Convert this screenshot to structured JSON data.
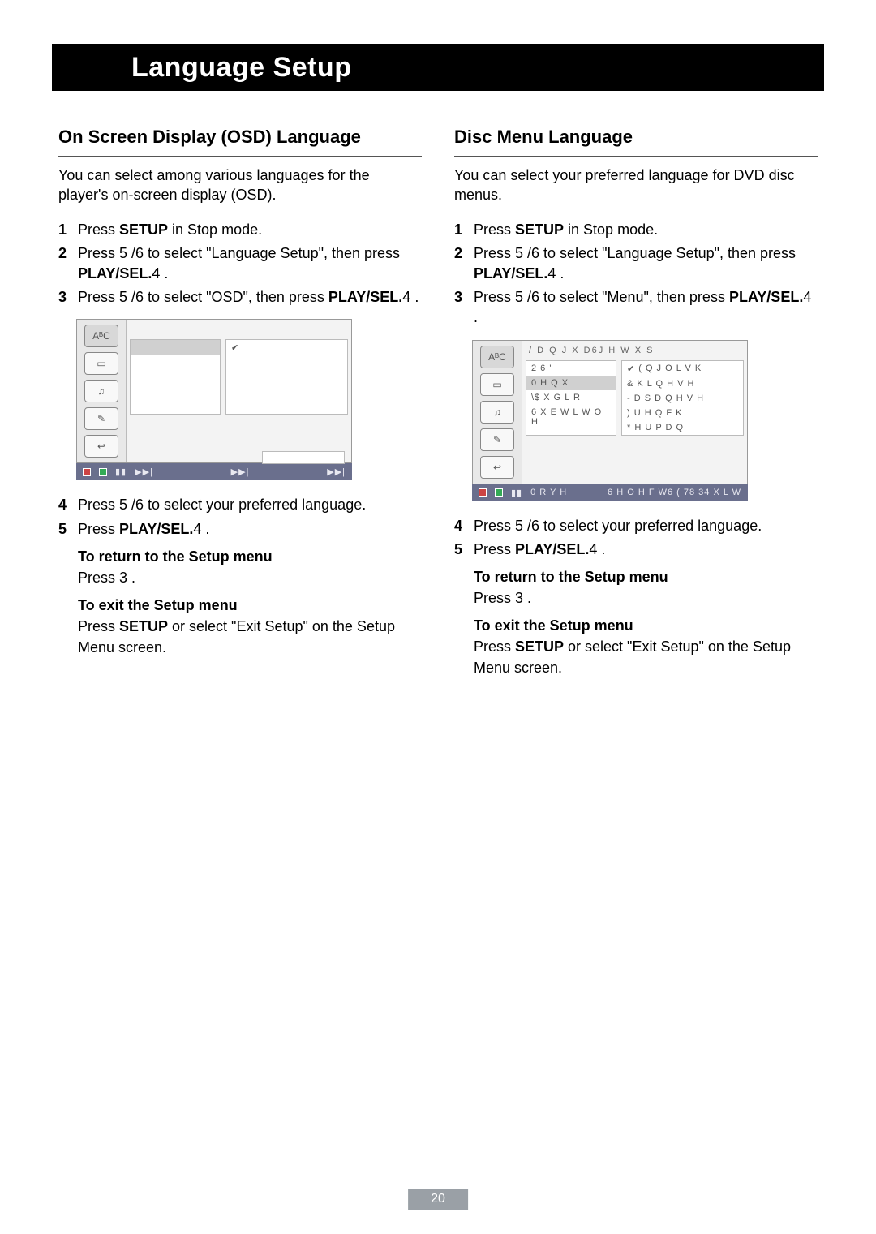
{
  "page_title": "Language Setup",
  "page_number": "20",
  "left": {
    "heading": "On Screen Display (OSD) Language",
    "intro": "You can select among various languages for the player's on-screen display (OSD).",
    "step1_pre": "Press ",
    "step1_b": "SETUP",
    "step1_post": " in Stop mode.",
    "step2_pre": "Press ",
    "step2_keys": "5  /6",
    "step2_mid": "  to select \"Language Setup\", then press ",
    "step2_b": "PLAY/SEL.",
    "step2_sym": "4",
    "step2_end": "  .",
    "step3_pre": "Press ",
    "step3_keys": "5  /6",
    "step3_mid": "  to select \"OSD\", then press ",
    "step3_b": "PLAY/SEL.",
    "step3_sym": "4",
    "step3_end": "  .",
    "step4_pre": "Press ",
    "step4_keys": "5  /6",
    "step4_post": "  to select your preferred language.",
    "step5_pre": "Press ",
    "step5_b": "PLAY/SEL.",
    "step5_sym": "4",
    "step5_end": "  .",
    "return_hdr": "To return to the Setup menu",
    "return_body_pre": "Press ",
    "return_body_sym": "3",
    "return_body_end": "  .",
    "exit_hdr": "To exit the Setup menu",
    "exit_body_pre": "Press ",
    "exit_body_b": "SETUP",
    "exit_body_post": " or select \"Exit Setup\" on the Setup Menu screen."
  },
  "right": {
    "heading": "Disc Menu Language",
    "intro": "You can select your preferred language for DVD disc menus.",
    "step1_pre": "Press ",
    "step1_b": "SETUP",
    "step1_post": " in Stop mode.",
    "step2_pre": "Press ",
    "step2_keys": "5  /6",
    "step2_mid": "  to select \"Language Setup\", then press ",
    "step2_b": "PLAY/SEL.",
    "step2_sym": "4",
    "step2_end": "  .",
    "step3_pre": "Press ",
    "step3_keys": "5  /6",
    "step3_mid": "  to select \"Menu\", then press ",
    "step3_b": "PLAY/SEL.",
    "step3_sym": "4",
    "step3_end": "  .",
    "step4_pre": "Press ",
    "step4_keys": "5  /6",
    "step4_post": "  to select your preferred language.",
    "step5_pre": "Press ",
    "step5_b": "PLAY/SEL.",
    "step5_sym": "4",
    "step5_end": "  .",
    "return_hdr": "To return to the Setup menu",
    "return_body_pre": "Press ",
    "return_body_sym": "3",
    "return_body_end": "  .",
    "exit_hdr": "To exit the Setup menu",
    "exit_body_pre": "Press ",
    "exit_body_b": "SETUP",
    "exit_body_post": " or select \"Exit Setup\" on the Setup Menu screen."
  },
  "osd_right": {
    "title": "/ D Q J X D6J H W X S",
    "listL": [
      "2 6 '",
      "0 H Q X",
      "\\$ X G L R",
      "6 X E W L W O H"
    ],
    "listR": [
      "( Q J O L V K",
      "& K L Q H V H",
      "- D S D Q H V H",
      ") U H Q F K",
      "* H U P D Q"
    ],
    "footer_move": "0 R Y H",
    "footer_sel": "6 H O H F W6 ( 78 34 X L W"
  }
}
